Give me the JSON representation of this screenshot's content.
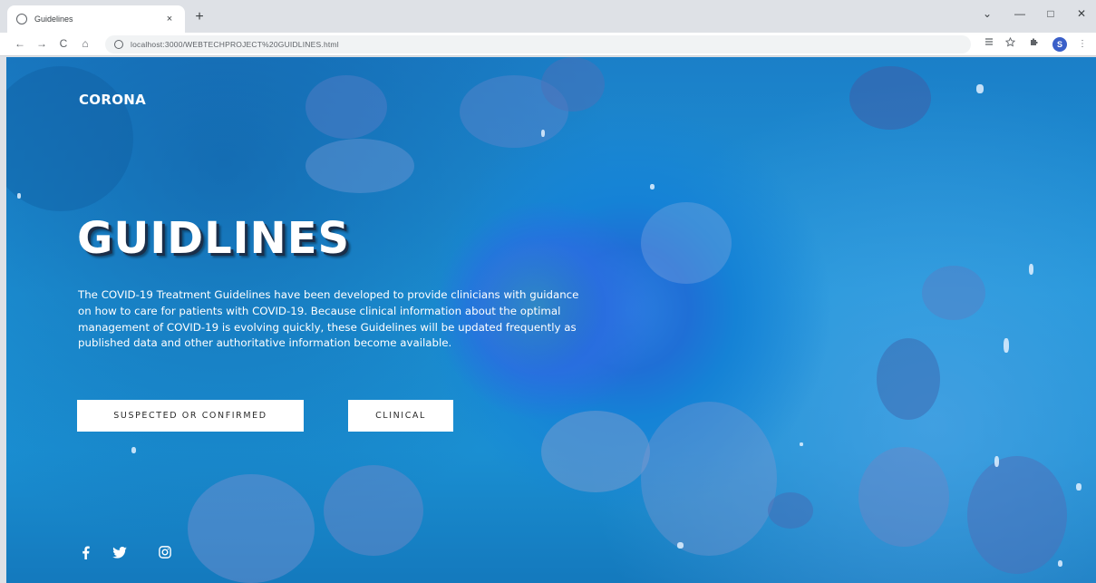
{
  "browser": {
    "tab_title": "Guidelines",
    "tab_close": "×",
    "new_tab": "+",
    "url": "localhost:3000/WEBTECHPROJECT%20GUIDLINES.html",
    "back": "←",
    "forward": "→",
    "reload": "C",
    "home": "⌂",
    "minimize": "—",
    "maximize": "□",
    "close": "✕",
    "chevron": "⌄",
    "menu": "⋮",
    "profile_initial": "S"
  },
  "page": {
    "brand": "CORONA",
    "headline": "GUIDLINES",
    "description": "The COVID-19 Treatment Guidelines have been developed to provide clinicians with guidance on how to care for patients with COVID-19. Because clinical information about the optimal management of COVID-19 is evolving quickly, these Guidelines will be updated frequently as published data and other authoritative information become available.",
    "buttons": {
      "suspected": "SUSPECTED OR CONFIRMED",
      "clinical": "CLINICAL"
    },
    "social": [
      "facebook-icon",
      "twitter-icon",
      "instagram-icon"
    ]
  }
}
